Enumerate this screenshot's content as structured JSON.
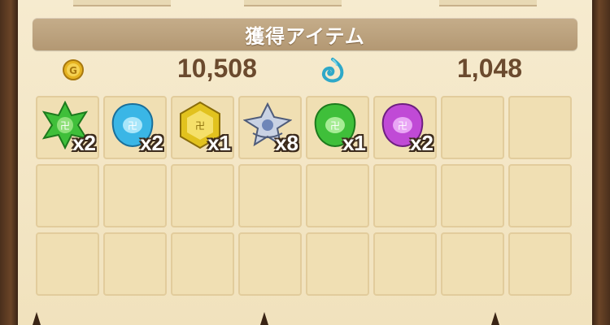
{
  "header": {
    "title": "獲得アイテム"
  },
  "resources": {
    "gold": {
      "icon": "gold-coin-icon",
      "value": "10,508"
    },
    "spirit": {
      "icon": "blue-spirit-icon",
      "value": "1,048"
    }
  },
  "colors": {
    "green": "#3fbf3a",
    "blue": "#3ab6e6",
    "yellow": "#e2c21e",
    "purple": "#c04ad6",
    "silver": "#8c9ab8"
  },
  "items": [
    {
      "icon": "green-star-gem-icon",
      "qty": "x2"
    },
    {
      "icon": "blue-gem-icon",
      "qty": "x2"
    },
    {
      "icon": "yellow-hex-gem-icon",
      "qty": "x1"
    },
    {
      "icon": "silver-ornament-icon",
      "qty": "x8"
    },
    {
      "icon": "green-gem-icon",
      "qty": "x1"
    },
    {
      "icon": "purple-gem-icon",
      "qty": "x2"
    }
  ]
}
